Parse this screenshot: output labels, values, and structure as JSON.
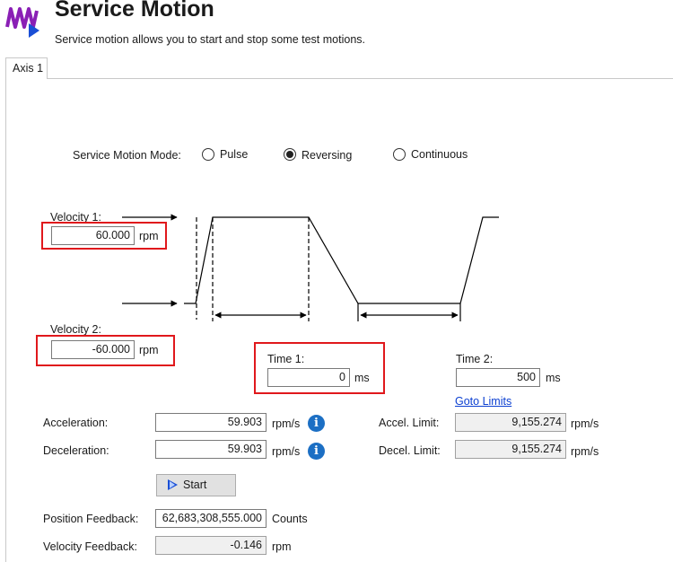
{
  "header": {
    "title": "Service Motion",
    "subtitle": "Service motion allows you to start and stop some test motions."
  },
  "tabs": [
    {
      "label": "Axis 1",
      "active": true
    }
  ],
  "mode": {
    "label": "Service Motion Mode:",
    "options": [
      {
        "label": "Pulse",
        "selected": false
      },
      {
        "label": "Reversing",
        "selected": true
      },
      {
        "label": "Continuous",
        "selected": false
      }
    ]
  },
  "velocity1": {
    "label": "Velocity 1:",
    "value": "60.000",
    "unit": "rpm"
  },
  "velocity2": {
    "label": "Velocity 2:",
    "value": "-60.000",
    "unit": "rpm"
  },
  "time1": {
    "label": "Time 1:",
    "value": "0",
    "unit": "ms"
  },
  "time2": {
    "label": "Time 2:",
    "value": "500",
    "unit": "ms"
  },
  "goto_limits": "Goto Limits",
  "acceleration": {
    "label": "Acceleration:",
    "value": "59.903",
    "unit": "rpm/s"
  },
  "deceleration": {
    "label": "Deceleration:",
    "value": "59.903",
    "unit": "rpm/s"
  },
  "accel_limit": {
    "label": "Accel. Limit:",
    "value": "9,155.274",
    "unit": "rpm/s"
  },
  "decel_limit": {
    "label": "Decel. Limit:",
    "value": "9,155.274",
    "unit": "rpm/s"
  },
  "start_button": {
    "label": "Start"
  },
  "position_feedback": {
    "label": "Position Feedback:",
    "value": "62,683,308,555.000",
    "unit": "Counts"
  },
  "velocity_feedback": {
    "label": "Velocity Feedback:",
    "value": "-0.146",
    "unit": "rpm"
  },
  "colors": {
    "logo": "#8a1fb5",
    "play": "#1a4fd6",
    "highlight": "#e0181c",
    "link": "#0b3fd1",
    "info": "#1c6fc4"
  }
}
